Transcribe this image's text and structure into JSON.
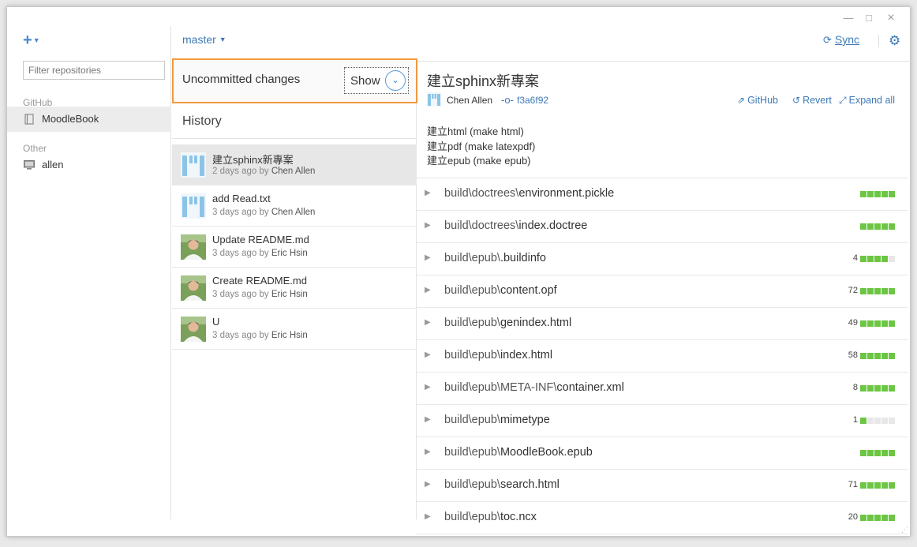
{
  "window_controls": {
    "minimize": "—",
    "maximize": "□",
    "close": "×"
  },
  "sidebar": {
    "add_icon": "+",
    "filter_placeholder": "Filter repositories",
    "sections": [
      {
        "title": "GitHub",
        "items": [
          {
            "label": "MoodleBook",
            "icon": "repo-icon"
          }
        ]
      },
      {
        "title": "Other",
        "items": [
          {
            "label": "allen",
            "icon": "computer-icon"
          }
        ]
      }
    ]
  },
  "topbar": {
    "branch": "master",
    "sync_label": "Sync",
    "settings_icon": "gear-icon"
  },
  "uncommitted": {
    "label": "Uncommitted changes",
    "show_label": "Show"
  },
  "history": {
    "label": "History",
    "commits": [
      {
        "message": "建立sphinx新專案",
        "time": "2 days ago by",
        "author": "Chen Allen",
        "avatar": "identicon",
        "selected": true
      },
      {
        "message": "add Read.txt",
        "time": "3 days ago by",
        "author": "Chen Allen",
        "avatar": "identicon",
        "selected": false
      },
      {
        "message": "Update README.md",
        "time": "3 days ago by",
        "author": "Eric Hsin",
        "avatar": "photo",
        "selected": false
      },
      {
        "message": "Create README.md",
        "time": "3 days ago by",
        "author": "Eric Hsin",
        "avatar": "photo",
        "selected": false
      },
      {
        "message": "U",
        "time": "3 days ago by",
        "author": "Eric Hsin",
        "avatar": "photo",
        "selected": false
      }
    ]
  },
  "detail": {
    "title": "建立sphinx新專案",
    "author": "Chen Allen",
    "sha": "f3a6f92",
    "actions": {
      "github": "GitHub",
      "revert": "Revert",
      "expand": "Expand all"
    },
    "body": [
      "建立html (make html)",
      "建立pdf (make latexpdf)",
      "建立epub (make epub)"
    ],
    "files": [
      {
        "dir": "build\\doctrees\\",
        "name": "environment.pickle",
        "count": "",
        "filled": 5
      },
      {
        "dir": "build\\doctrees\\",
        "name": "index.doctree",
        "count": "",
        "filled": 5
      },
      {
        "dir": "build\\epub\\",
        "name": ".buildinfo",
        "count": "4",
        "filled": 4
      },
      {
        "dir": "build\\epub\\",
        "name": "content.opf",
        "count": "72",
        "filled": 5
      },
      {
        "dir": "build\\epub\\",
        "name": "genindex.html",
        "count": "49",
        "filled": 5
      },
      {
        "dir": "build\\epub\\",
        "name": "index.html",
        "count": "58",
        "filled": 5
      },
      {
        "dir": "build\\epub\\META-INF\\",
        "name": "container.xml",
        "count": "8",
        "filled": 5
      },
      {
        "dir": "build\\epub\\",
        "name": "mimetype",
        "count": "1",
        "filled": 1
      },
      {
        "dir": "build\\epub\\",
        "name": "MoodleBook.epub",
        "count": "",
        "filled": 5
      },
      {
        "dir": "build\\epub\\",
        "name": "search.html",
        "count": "71",
        "filled": 5
      },
      {
        "dir": "build\\epub\\",
        "name": "toc.ncx",
        "count": "20",
        "filled": 5
      }
    ]
  },
  "colors": {
    "accent": "#3d7ab8",
    "highlight_border": "#f29a3e",
    "diff_add": "#6cc644",
    "diff_empty": "#e8e8e8"
  }
}
